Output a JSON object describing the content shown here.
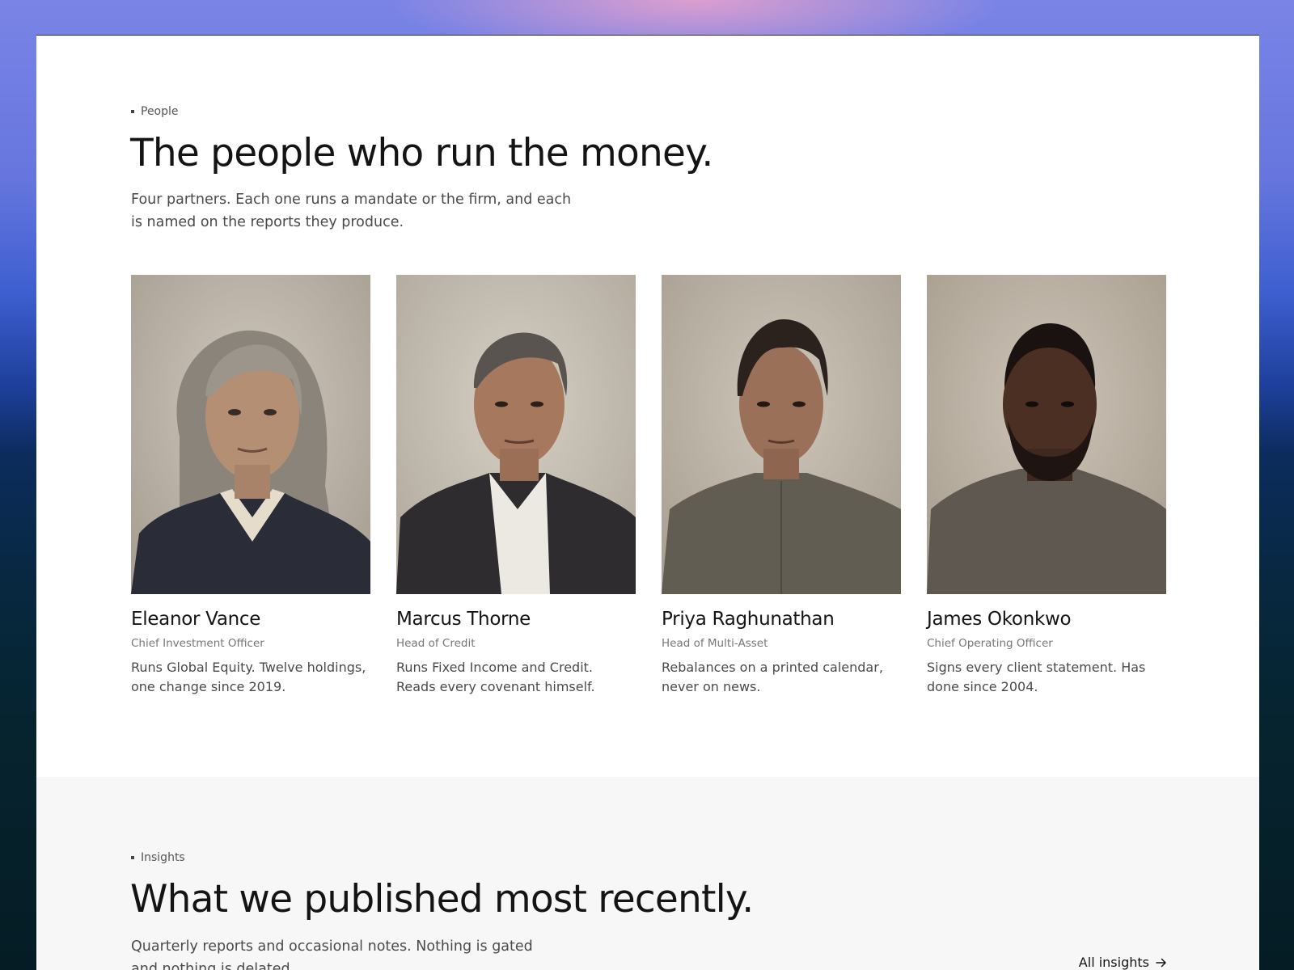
{
  "people": {
    "eyebrow": "People",
    "title": "The people who run the money.",
    "lead": "Four partners. Each one runs a mandate or the firm, and each is named on the reports they produce.",
    "partners": [
      {
        "name": "Eleanor Vance",
        "role": "Chief Investment Officer",
        "description": "Runs Global Equity. Twelve holdings, one change since 2019."
      },
      {
        "name": "Marcus Thorne",
        "role": "Head of Credit",
        "description": "Runs Fixed Income and Credit. Reads every covenant himself."
      },
      {
        "name": "Priya Raghunathan",
        "role": "Head of Multi-Asset",
        "description": "Rebalances on a printed calendar, never on news."
      },
      {
        "name": "James Okonkwo",
        "role": "Chief Operating Officer",
        "description": "Signs every client statement. Has done since 2004."
      }
    ]
  },
  "insights": {
    "eyebrow": "Insights",
    "title": "What we published most recently.",
    "lead": "Quarterly reports and occasional notes. Nothing is gated and nothing is delated.",
    "all_link": "All insights",
    "all_link_icon": "arrow-right-icon"
  },
  "colors": {
    "accent_text": "#141414",
    "muted_text": "#4a4a4a",
    "section_alt_bg": "#f7f7f7"
  }
}
